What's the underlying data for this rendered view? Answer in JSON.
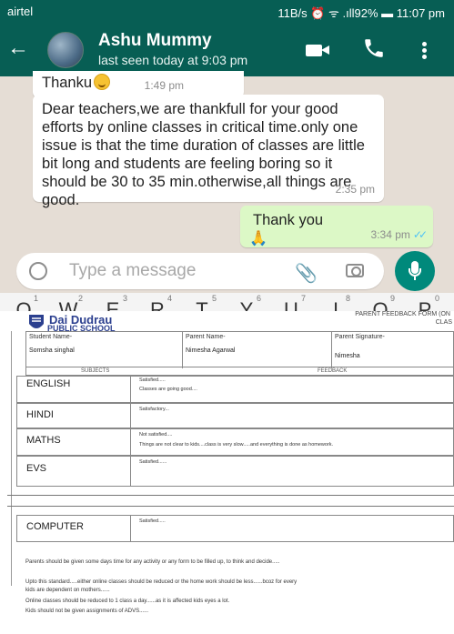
{
  "status_bar": {
    "left": "airtel",
    "right": "11B/s ⏰ ᯤ .ıll92% ▬ 11:07 pm"
  },
  "chat_header": {
    "name": "Ashu Mummy",
    "last_seen": "last seen today at 9:03 pm"
  },
  "messages": [
    {
      "direction": "in",
      "text": "Thanku",
      "time": "1:49 pm"
    },
    {
      "direction": "in",
      "text": "Dear teachers,we are thankfull for your good efforts by online classes in critical time.only one issue is that  the time duration of classes  are little bit long and students are feeling boring so it should be 30 to 35 min.otherwise,all things are good.",
      "time": "2:35 pm"
    },
    {
      "direction": "out",
      "text": "Thank you",
      "time": "3:34 pm"
    }
  ],
  "composer": {
    "placeholder": "Type a message"
  },
  "keyboard_row": [
    {
      "num": "1",
      "ch": "Q"
    },
    {
      "num": "2",
      "ch": "W"
    },
    {
      "num": "3",
      "ch": "E"
    },
    {
      "num": "4",
      "ch": "R"
    },
    {
      "num": "5",
      "ch": "T"
    },
    {
      "num": "6",
      "ch": "Y"
    },
    {
      "num": "7",
      "ch": "U"
    },
    {
      "num": "8",
      "ch": "I"
    },
    {
      "num": "9",
      "ch": "O"
    },
    {
      "num": "0",
      "ch": "P"
    }
  ],
  "form": {
    "school_name_line1": "Dai Dudrau",
    "school_name_line2": "PUBLIC SCHOOL",
    "form_title": "PARENT FEEDBACK FORM (ON",
    "class_label": "CLAS",
    "student_label": "Student Name-",
    "student_value": "Somsha singhal",
    "parent_label": "Parent Name-",
    "parent_value": "Nimesha Agarwal",
    "signature_label": "Parent Signature-",
    "signature_value": "Nimesha",
    "subjects_header": "SUBJECTS",
    "feedback_header": "FEEDBACK",
    "subjects": [
      {
        "name": "ENGLISH",
        "fb1": "Satisfied.....",
        "fb2": "Classes are going good...."
      },
      {
        "name": "HINDI",
        "fb1": "Satisfactory...",
        "fb2": ""
      },
      {
        "name": "MATHS",
        "fb1": "Not satisfied....",
        "fb2": "Things are not clear to kids....class is very slow.....and everything is done as homework."
      },
      {
        "name": "EVS",
        "fb1": "Satisfied......",
        "fb2": ""
      },
      {
        "name": "COMPUTER",
        "fb1": "Satisfied.....",
        "fb2": ""
      }
    ],
    "remarks": [
      "Parents should be given some days time for any activity or any form to be filled up, to think and decide.....",
      "Upto this standard.....either online classes should be reduced or the home work should be less......bcoz for every",
      "kids are dependent on mothers......",
      "Online classes should be reduced to 1 class a day......as it is affected kids eyes a lot.",
      "Kids should not be given assignments of ADVS......"
    ]
  }
}
